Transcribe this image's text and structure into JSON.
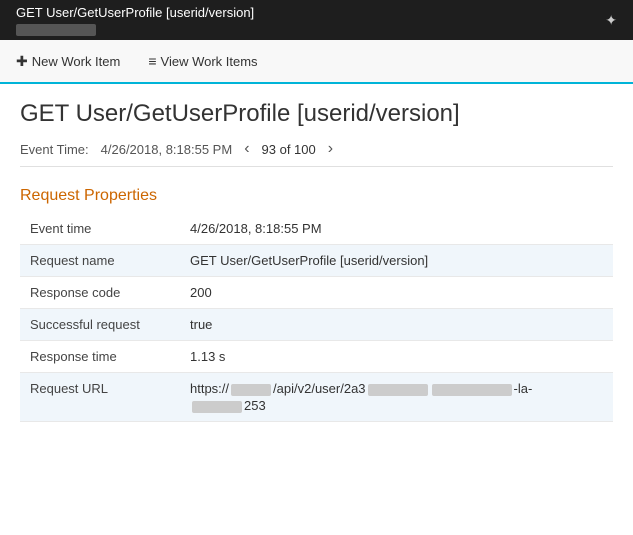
{
  "titleBar": {
    "text": "GET User/GetUserProfile [userid/version]",
    "pin_icon": "📌"
  },
  "toolbar": {
    "new_work_item_label": "New Work Item",
    "view_work_items_label": "View Work Items"
  },
  "page": {
    "title": "GET User/GetUserProfile [userid/version]",
    "event_time_label": "Event Time:",
    "event_time_value": "4/26/2018, 8:18:55 PM",
    "nav_prev": "‹",
    "nav_next": "›",
    "nav_count": "93 of 100",
    "section_heading": "Request Properties",
    "properties": [
      {
        "label": "Event time",
        "value": "4/26/2018, 8:18:55 PM"
      },
      {
        "label": "Request name",
        "value": "GET User/GetUserProfile [userid/version]"
      },
      {
        "label": "Response code",
        "value": "200"
      },
      {
        "label": "Successful request",
        "value": "true"
      },
      {
        "label": "Response time",
        "value": "1.13 s"
      },
      {
        "label": "Request URL",
        "value": "url_special"
      }
    ]
  }
}
